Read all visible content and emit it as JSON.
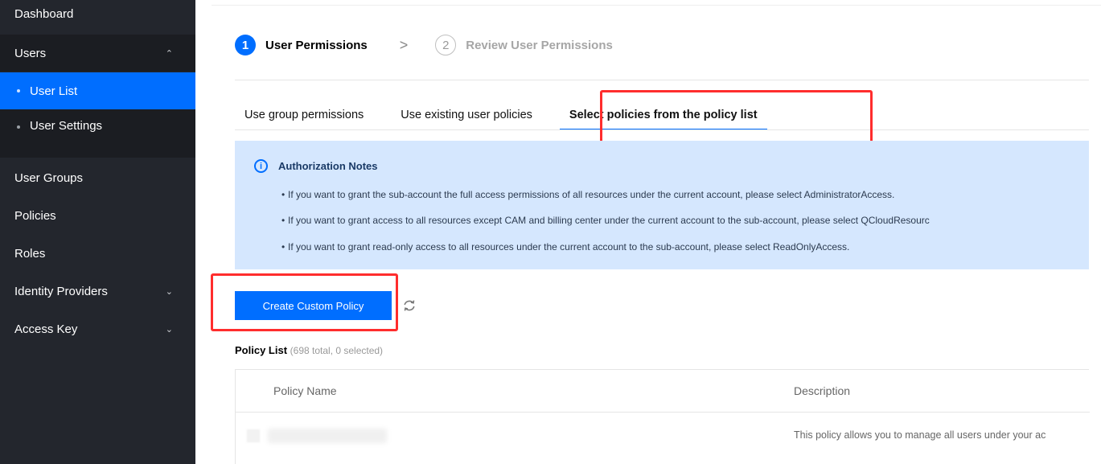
{
  "sidebar": {
    "items": [
      {
        "label": "Dashboard"
      },
      {
        "label": "Users",
        "chevron": "^"
      },
      {
        "label": "User List",
        "active": true
      },
      {
        "label": "User Settings"
      },
      {
        "label": "User Groups"
      },
      {
        "label": "Policies"
      },
      {
        "label": "Roles"
      },
      {
        "label": "Identity Providers",
        "chevron": "v"
      },
      {
        "label": "Access Key",
        "chevron": "v"
      }
    ]
  },
  "steps": [
    {
      "num": "1",
      "label": "User Permissions",
      "state": "active"
    },
    {
      "num": "2",
      "label": "Review User Permissions",
      "state": "inactive"
    }
  ],
  "step_separator": ">",
  "tabs": [
    {
      "label": "Use group permissions"
    },
    {
      "label": "Use existing user policies"
    },
    {
      "label": "Select policies from the policy list",
      "active": true
    }
  ],
  "notes": {
    "icon": "info-icon",
    "title": "Authorization Notes",
    "items": [
      "If you want to grant the sub-account the full access permissions of all resources under the current account, please select AdministratorAccess.",
      "If you want to grant access to all resources except CAM and billing center under the current account to the sub-account, please select QCloudResourc",
      "If you want to grant read-only access to all resources under the current account to the sub-account, please select ReadOnlyAccess."
    ]
  },
  "toolbar": {
    "create_label": "Create Custom Policy",
    "refresh_icon": "refresh-icon"
  },
  "policy_list": {
    "title": "Policy List",
    "count": "(698 total, 0 selected)",
    "columns": [
      "Policy Name",
      "Description"
    ],
    "rows": [
      {
        "name": "",
        "description": "This policy allows you to manage all users under your ac"
      }
    ]
  },
  "colors": {
    "accent": "#006eff",
    "sidebar_bg": "#23262d",
    "notes_bg": "#d5e7fe",
    "highlight": "#ff2d2d"
  }
}
